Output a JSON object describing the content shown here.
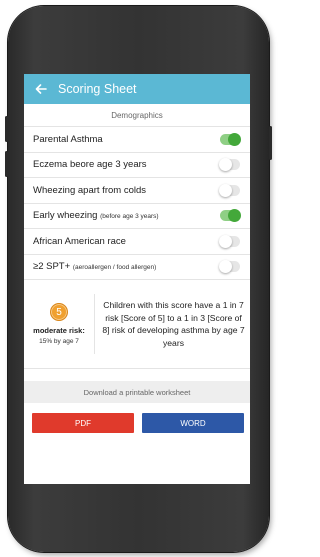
{
  "header": {
    "title": "Scoring Sheet",
    "back_icon": "back-arrow-icon"
  },
  "section_title": "Demographics",
  "rows": [
    {
      "label": "Parental Asthma",
      "sub": "",
      "on": true
    },
    {
      "label": "Eczema beore age 3 years",
      "sub": "",
      "on": false
    },
    {
      "label": "Wheezing apart from colds",
      "sub": "",
      "on": false
    },
    {
      "label": "Early wheezing",
      "sub": "(before age 3 years)",
      "on": true
    },
    {
      "label": "African American race",
      "sub": "",
      "on": false
    },
    {
      "label": "≥2 SPT+",
      "sub": "(aeroallergen / food allergen)",
      "on": false
    }
  ],
  "result": {
    "score": "5",
    "risk_label": "moderate risk:",
    "risk_sub": "15% by age 7",
    "text": "Children with this score have a 1 in 7 risk [Score of 5] to a 1 in 3 [Score of 8] risk of developing asthma by age 7 years"
  },
  "download_label": "Download a printable worksheet",
  "buttons": {
    "pdf": "PDF",
    "word": "WORD"
  },
  "colors": {
    "header": "#5bb8d4",
    "toggle_on": "#43a83a",
    "score_badge": "#f0a030",
    "pdf": "#e03a2c",
    "word": "#2d58a7"
  }
}
